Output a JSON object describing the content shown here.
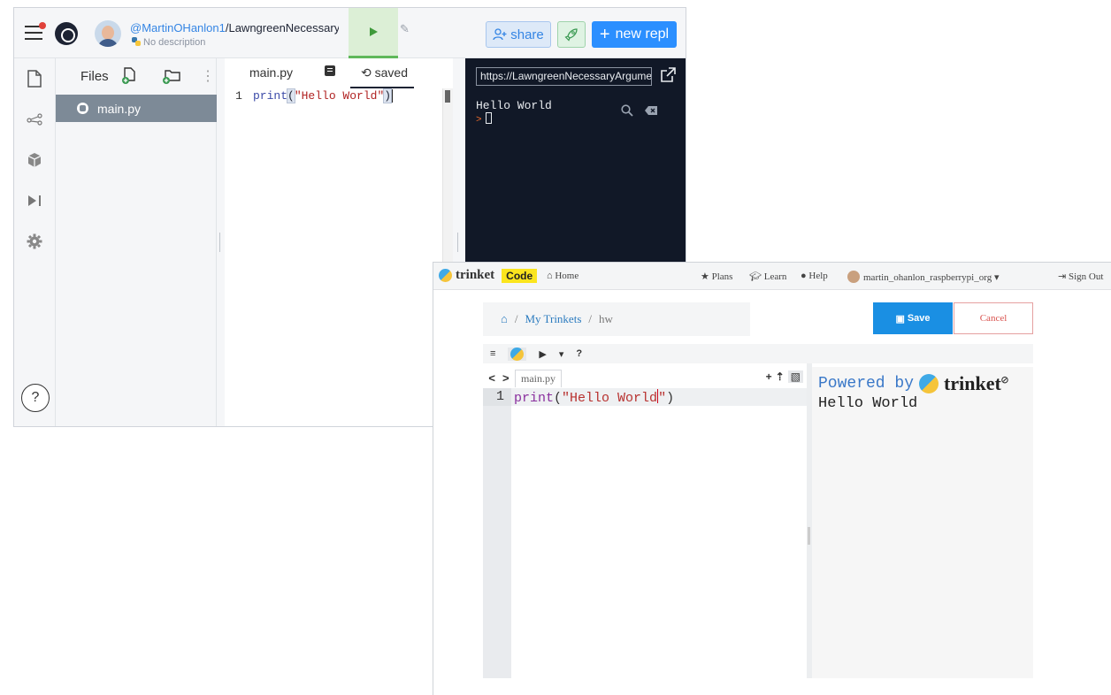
{
  "replit": {
    "user": "@MartinOHanlon1",
    "repl_name": "/LawngreenNecessaryArgument",
    "description": "No description",
    "share_label": "share",
    "new_repl_label": "new repl",
    "files_label": "Files",
    "file_name": "main.py",
    "editor_tab": "main.py",
    "saved_label": "saved",
    "line_number": "1",
    "code_fn": "print",
    "code_str": "\"Hello World\"",
    "url": "https://LawngreenNecessaryArgument",
    "console_output": "Hello World",
    "prompt": ">",
    "help_label": "?"
  },
  "trinket": {
    "brand": "trinket",
    "code_badge": "Code",
    "nav": {
      "home": "Home",
      "plans": "Plans",
      "learn": "Learn",
      "help": "Help",
      "user": "martin_ohanlon_raspberrypi_org",
      "sign_out": "Sign Out"
    },
    "breadcrumb": {
      "sep": "/",
      "my_trinkets": "My Trinkets",
      "current": "hw"
    },
    "save_label": "Save",
    "cancel_label": "Cancel",
    "toolbar": {
      "menu": "≡",
      "run": "▶",
      "dropdown": "▾",
      "help": "?"
    },
    "file_tab": "main.py",
    "line_number": "1",
    "code_fn": "print",
    "code_str_a": "\"Hello World",
    "code_str_b": "\"",
    "code_close": ")",
    "powered_by": "Powered by",
    "output": "Hello World"
  },
  "colors": {
    "replit_accent": "#2b8fff",
    "replit_run": "#5fb85a",
    "replit_console_bg": "#111827",
    "trinket_save": "#1a8fe3",
    "trinket_code_badge": "#fbe51e"
  }
}
